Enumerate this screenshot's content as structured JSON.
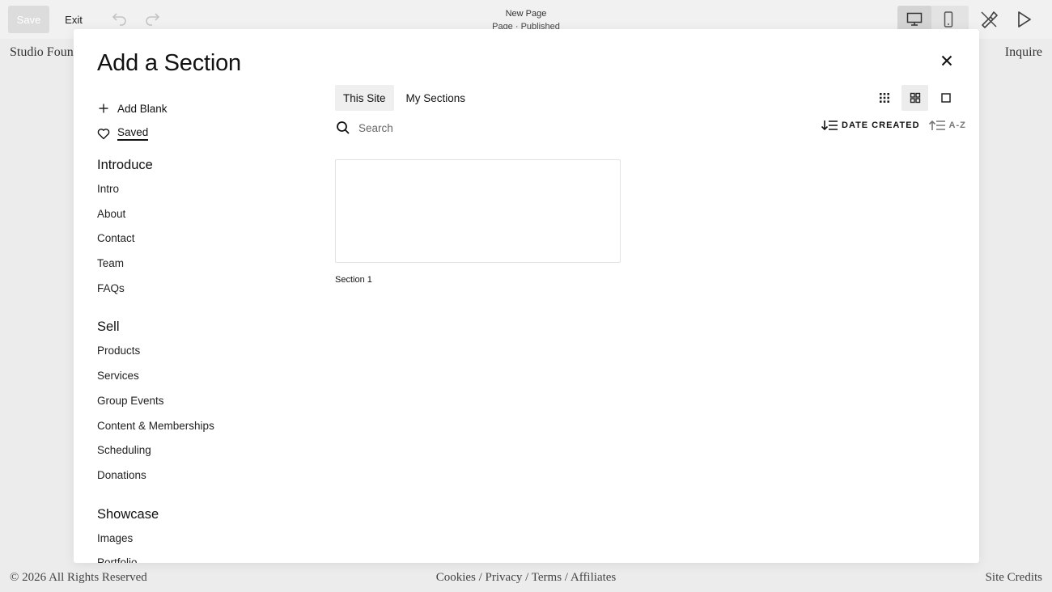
{
  "topbar": {
    "save_label": "Save",
    "exit_label": "Exit",
    "page_title": "New Page",
    "page_status": "Page · Published"
  },
  "site": {
    "logo": "Studio Found",
    "nav_inquire": "Inquire",
    "footer_copyright": "© 2026 All Rights Reserved",
    "footer_links": "Cookies / Privacy / Terms / Affiliates",
    "footer_credits": "Site Credits"
  },
  "modal": {
    "title": "Add a Section",
    "add_blank_label": "Add Blank",
    "saved_label": "Saved",
    "categories": [
      {
        "title": "Introduce",
        "items": [
          "Intro",
          "About",
          "Contact",
          "Team",
          "FAQs"
        ]
      },
      {
        "title": "Sell",
        "items": [
          "Products",
          "Services",
          "Group Events",
          "Content & Memberships",
          "Scheduling",
          "Donations"
        ]
      },
      {
        "title": "Showcase",
        "items": [
          "Images",
          "Portfolio"
        ]
      }
    ],
    "tabs": [
      {
        "label": "This Site",
        "active": true
      },
      {
        "label": "My Sections",
        "active": false
      }
    ],
    "search_placeholder": "Search",
    "sort_date_label": "DATE CREATED",
    "sort_az_label": "A-Z",
    "sections": [
      {
        "label": "Section 1"
      }
    ]
  },
  "colors": {
    "background": "#ececec",
    "modal_bg": "#ffffff",
    "text": "#111111",
    "tab_active_bg": "#efefef"
  }
}
